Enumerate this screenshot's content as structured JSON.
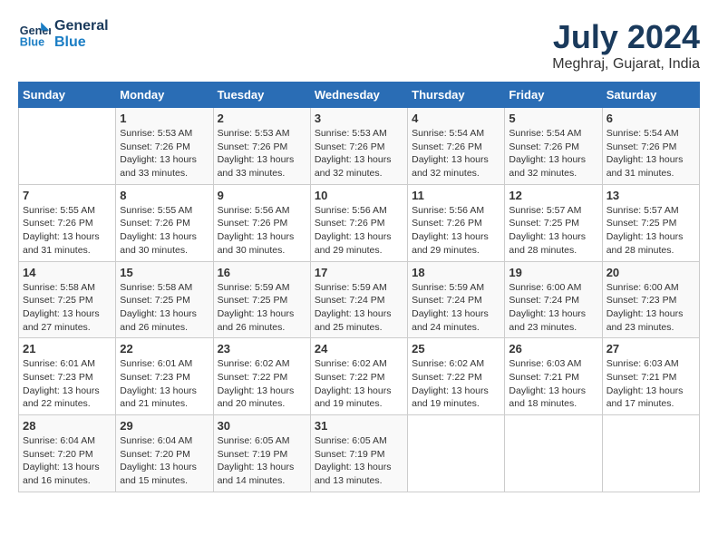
{
  "logo": {
    "line1": "General",
    "line2": "Blue"
  },
  "title": "July 2024",
  "subtitle": "Meghraj, Gujarat, India",
  "days_header": [
    "Sunday",
    "Monday",
    "Tuesday",
    "Wednesday",
    "Thursday",
    "Friday",
    "Saturday"
  ],
  "weeks": [
    [
      {
        "day": "",
        "info": ""
      },
      {
        "day": "1",
        "info": "Sunrise: 5:53 AM\nSunset: 7:26 PM\nDaylight: 13 hours\nand 33 minutes."
      },
      {
        "day": "2",
        "info": "Sunrise: 5:53 AM\nSunset: 7:26 PM\nDaylight: 13 hours\nand 33 minutes."
      },
      {
        "day": "3",
        "info": "Sunrise: 5:53 AM\nSunset: 7:26 PM\nDaylight: 13 hours\nand 32 minutes."
      },
      {
        "day": "4",
        "info": "Sunrise: 5:54 AM\nSunset: 7:26 PM\nDaylight: 13 hours\nand 32 minutes."
      },
      {
        "day": "5",
        "info": "Sunrise: 5:54 AM\nSunset: 7:26 PM\nDaylight: 13 hours\nand 32 minutes."
      },
      {
        "day": "6",
        "info": "Sunrise: 5:54 AM\nSunset: 7:26 PM\nDaylight: 13 hours\nand 31 minutes."
      }
    ],
    [
      {
        "day": "7",
        "info": "Sunrise: 5:55 AM\nSunset: 7:26 PM\nDaylight: 13 hours\nand 31 minutes."
      },
      {
        "day": "8",
        "info": "Sunrise: 5:55 AM\nSunset: 7:26 PM\nDaylight: 13 hours\nand 30 minutes."
      },
      {
        "day": "9",
        "info": "Sunrise: 5:56 AM\nSunset: 7:26 PM\nDaylight: 13 hours\nand 30 minutes."
      },
      {
        "day": "10",
        "info": "Sunrise: 5:56 AM\nSunset: 7:26 PM\nDaylight: 13 hours\nand 29 minutes."
      },
      {
        "day": "11",
        "info": "Sunrise: 5:56 AM\nSunset: 7:26 PM\nDaylight: 13 hours\nand 29 minutes."
      },
      {
        "day": "12",
        "info": "Sunrise: 5:57 AM\nSunset: 7:25 PM\nDaylight: 13 hours\nand 28 minutes."
      },
      {
        "day": "13",
        "info": "Sunrise: 5:57 AM\nSunset: 7:25 PM\nDaylight: 13 hours\nand 28 minutes."
      }
    ],
    [
      {
        "day": "14",
        "info": "Sunrise: 5:58 AM\nSunset: 7:25 PM\nDaylight: 13 hours\nand 27 minutes."
      },
      {
        "day": "15",
        "info": "Sunrise: 5:58 AM\nSunset: 7:25 PM\nDaylight: 13 hours\nand 26 minutes."
      },
      {
        "day": "16",
        "info": "Sunrise: 5:59 AM\nSunset: 7:25 PM\nDaylight: 13 hours\nand 26 minutes."
      },
      {
        "day": "17",
        "info": "Sunrise: 5:59 AM\nSunset: 7:24 PM\nDaylight: 13 hours\nand 25 minutes."
      },
      {
        "day": "18",
        "info": "Sunrise: 5:59 AM\nSunset: 7:24 PM\nDaylight: 13 hours\nand 24 minutes."
      },
      {
        "day": "19",
        "info": "Sunrise: 6:00 AM\nSunset: 7:24 PM\nDaylight: 13 hours\nand 23 minutes."
      },
      {
        "day": "20",
        "info": "Sunrise: 6:00 AM\nSunset: 7:23 PM\nDaylight: 13 hours\nand 23 minutes."
      }
    ],
    [
      {
        "day": "21",
        "info": "Sunrise: 6:01 AM\nSunset: 7:23 PM\nDaylight: 13 hours\nand 22 minutes."
      },
      {
        "day": "22",
        "info": "Sunrise: 6:01 AM\nSunset: 7:23 PM\nDaylight: 13 hours\nand 21 minutes."
      },
      {
        "day": "23",
        "info": "Sunrise: 6:02 AM\nSunset: 7:22 PM\nDaylight: 13 hours\nand 20 minutes."
      },
      {
        "day": "24",
        "info": "Sunrise: 6:02 AM\nSunset: 7:22 PM\nDaylight: 13 hours\nand 19 minutes."
      },
      {
        "day": "25",
        "info": "Sunrise: 6:02 AM\nSunset: 7:22 PM\nDaylight: 13 hours\nand 19 minutes."
      },
      {
        "day": "26",
        "info": "Sunrise: 6:03 AM\nSunset: 7:21 PM\nDaylight: 13 hours\nand 18 minutes."
      },
      {
        "day": "27",
        "info": "Sunrise: 6:03 AM\nSunset: 7:21 PM\nDaylight: 13 hours\nand 17 minutes."
      }
    ],
    [
      {
        "day": "28",
        "info": "Sunrise: 6:04 AM\nSunset: 7:20 PM\nDaylight: 13 hours\nand 16 minutes."
      },
      {
        "day": "29",
        "info": "Sunrise: 6:04 AM\nSunset: 7:20 PM\nDaylight: 13 hours\nand 15 minutes."
      },
      {
        "day": "30",
        "info": "Sunrise: 6:05 AM\nSunset: 7:19 PM\nDaylight: 13 hours\nand 14 minutes."
      },
      {
        "day": "31",
        "info": "Sunrise: 6:05 AM\nSunset: 7:19 PM\nDaylight: 13 hours\nand 13 minutes."
      },
      {
        "day": "",
        "info": ""
      },
      {
        "day": "",
        "info": ""
      },
      {
        "day": "",
        "info": ""
      }
    ]
  ]
}
